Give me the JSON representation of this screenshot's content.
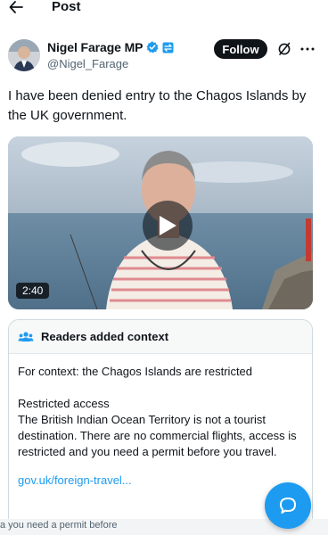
{
  "header": {
    "title": "Post",
    "back_icon": "arrow-left-icon"
  },
  "author": {
    "display_name": "Nigel Farage MP",
    "handle": "@Nigel_Farage",
    "verified_color": "#1d9bf0"
  },
  "actions": {
    "follow_label": "Follow",
    "grok_icon": "grok-icon",
    "more_icon": "more-icon"
  },
  "post": {
    "text": "I have been denied entry to the Chagos Islands by the UK government."
  },
  "media": {
    "duration": "2:40",
    "play_icon": "play-icon"
  },
  "context_note": {
    "title": "Readers added context",
    "line1": "For context: the Chagos Islands are restricted",
    "heading": "Restricted access",
    "body": "The British Indian Ocean Territory is not a tourist destination. There are no commercial flights, access is restricted and you need a permit before you travel.",
    "link": "gov.uk/foreign-travel..."
  },
  "bottom_strip": {
    "text": "a you need a permit before"
  },
  "colors": {
    "accent": "#1d9bf0",
    "text": "#0f1419",
    "muted": "#536471"
  }
}
